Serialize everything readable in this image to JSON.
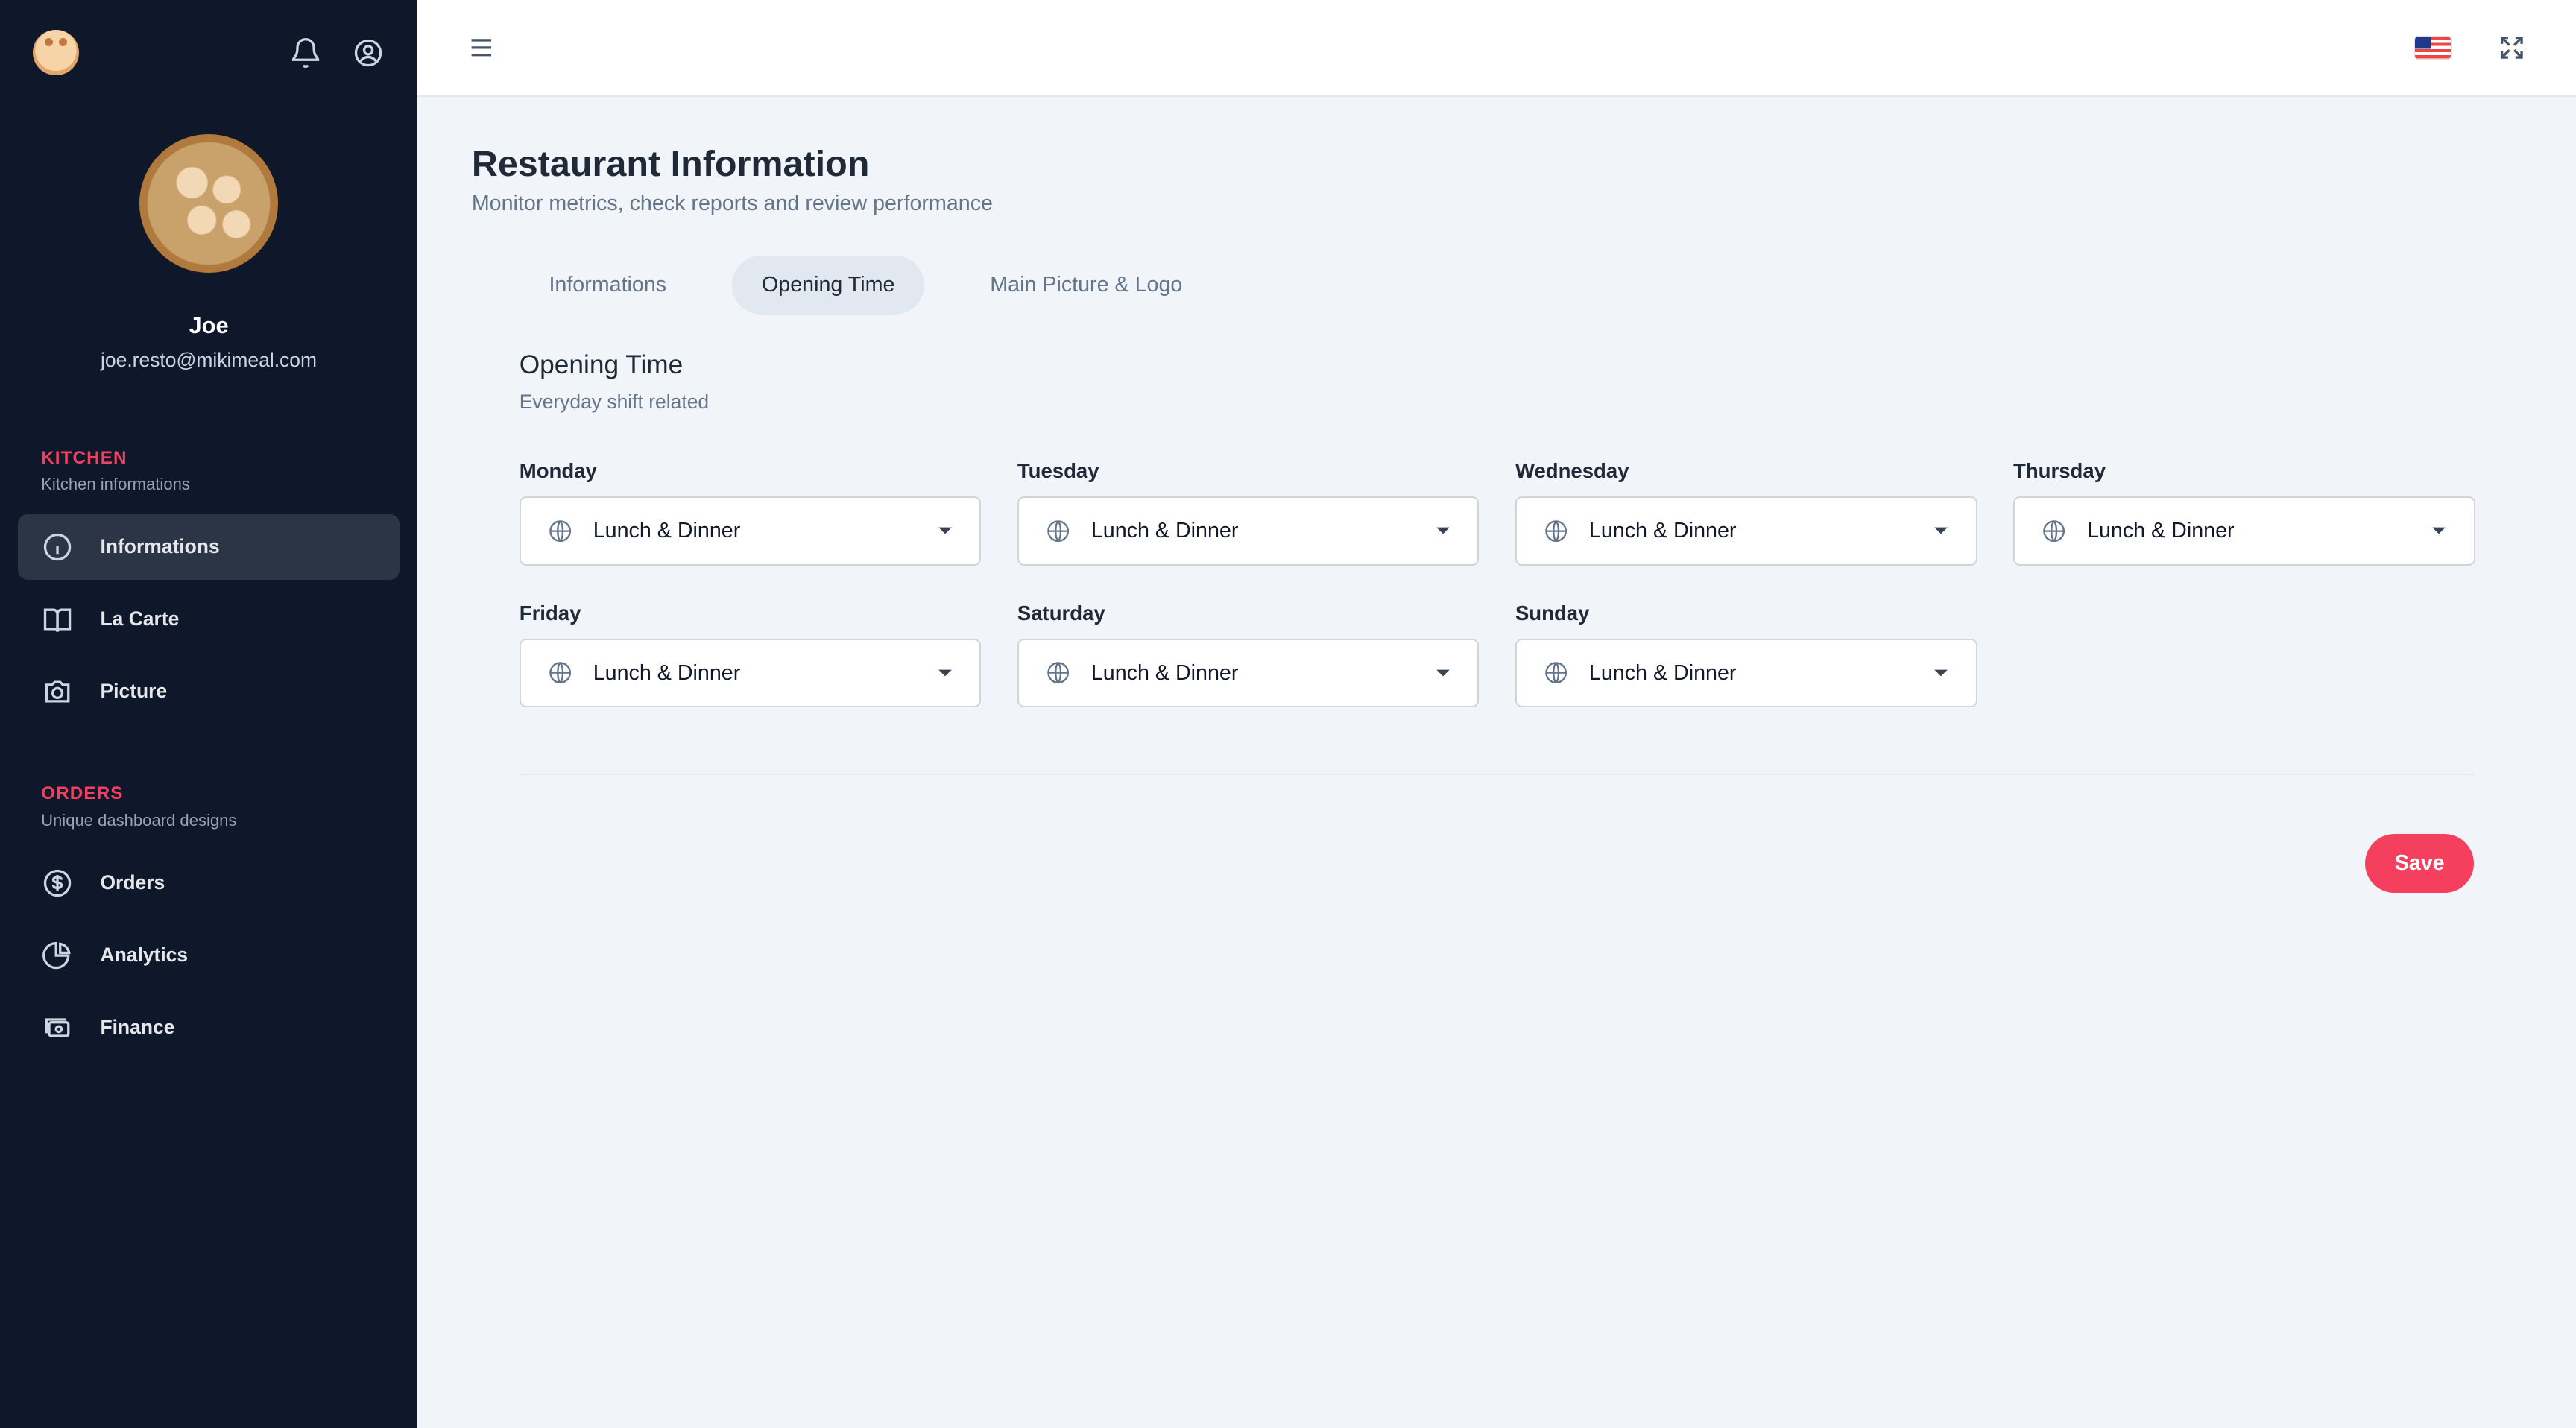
{
  "colors": {
    "sidebar_bg": "#0f172a",
    "main_bg": "#f1f5f9",
    "accent": "#f43f5e",
    "section_title": "#f43f5e"
  },
  "sidebar": {
    "profile": {
      "name": "Joe",
      "email": "joe.resto@mikimeal.com"
    },
    "top_icons": [
      "logo-icon",
      "bell-icon",
      "user-circle-icon"
    ],
    "sections": [
      {
        "title": "KITCHEN",
        "subtitle": "Kitchen informations",
        "items": [
          {
            "label": "Informations",
            "icon": "info-icon",
            "active": true
          },
          {
            "label": "La Carte",
            "icon": "book-open-icon",
            "active": false
          },
          {
            "label": "Picture",
            "icon": "camera-icon",
            "active": false
          }
        ]
      },
      {
        "title": "ORDERS",
        "subtitle": "Unique dashboard designs",
        "items": [
          {
            "label": "Orders",
            "icon": "dollar-circle-icon",
            "active": false
          },
          {
            "label": "Analytics",
            "icon": "pie-chart-icon",
            "active": false
          },
          {
            "label": "Finance",
            "icon": "cash-icon",
            "active": false
          }
        ]
      }
    ]
  },
  "topbar": {
    "left_icon": "hamburger-icon",
    "right_icons": [
      "us-flag-icon",
      "expand-icon"
    ]
  },
  "main": {
    "title": "Restaurant Information",
    "subtitle": "Monitor metrics, check reports and review performance",
    "tabs": [
      {
        "label": "Informations",
        "active": false
      },
      {
        "label": "Opening Time",
        "active": true
      },
      {
        "label": "Main Picture & Logo",
        "active": false
      }
    ],
    "card": {
      "title": "Opening Time",
      "subtitle": "Everyday shift related",
      "days": [
        {
          "label": "Monday",
          "value": "Lunch & Dinner"
        },
        {
          "label": "Tuesday",
          "value": "Lunch & Dinner"
        },
        {
          "label": "Wednesday",
          "value": "Lunch & Dinner"
        },
        {
          "label": "Thursday",
          "value": "Lunch & Dinner"
        },
        {
          "label": "Friday",
          "value": "Lunch & Dinner"
        },
        {
          "label": "Saturday",
          "value": "Lunch & Dinner"
        },
        {
          "label": "Sunday",
          "value": "Lunch & Dinner"
        }
      ]
    },
    "save_label": "Save"
  }
}
